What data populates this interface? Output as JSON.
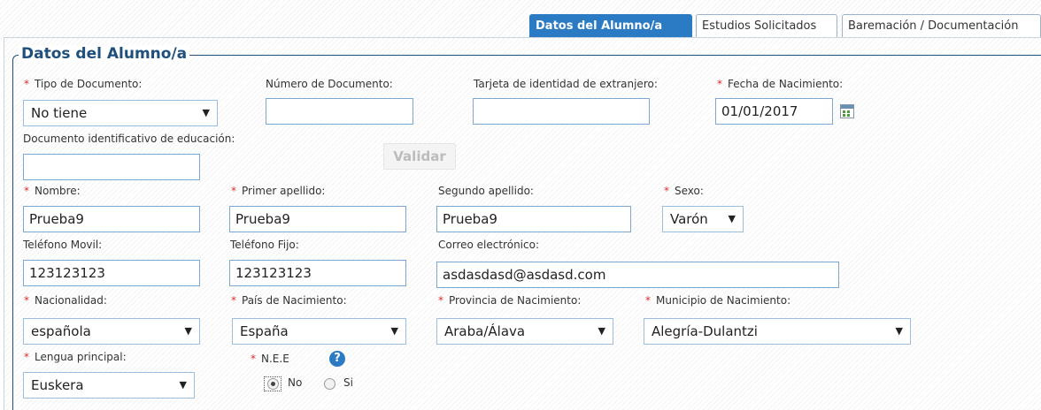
{
  "tabs": [
    "Datos del Alumno/a",
    "Estudios Solicitados",
    "Baremación / Documentación"
  ],
  "section_title": "Datos del Alumno/a",
  "required_mark": "*",
  "labels": {
    "tipo_documento": "Tipo de Documento:",
    "numero_documento": "Número de Documento:",
    "tarjeta_extranjero": "Tarjeta de identidad de extranjero:",
    "fecha_nacimiento": "Fecha de Nacimiento:",
    "doc_educacion": "Documento identificativo de educación:",
    "nombre": "Nombre:",
    "primer_apellido": "Primer apellido:",
    "segundo_apellido": "Segundo apellido:",
    "sexo": "Sexo:",
    "telefono_movil": "Teléfono Movil:",
    "telefono_fijo": "Teléfono Fijo:",
    "correo": "Correo electrónico:",
    "nacionalidad": "Nacionalidad:",
    "pais_nacimiento": "País de Nacimiento:",
    "provincia_nacimiento": "Provincia de Nacimiento:",
    "municipio_nacimiento": "Municipio de Nacimiento:",
    "lengua_principal": "Lengua principal:",
    "nee": "N.E.E"
  },
  "values": {
    "tipo_documento": "No tiene",
    "numero_documento": "",
    "tarjeta_extranjero": "",
    "fecha_nacimiento": "01/01/2017",
    "doc_educacion": "",
    "nombre": "Prueba9",
    "primer_apellido": "Prueba9",
    "segundo_apellido": "Prueba9",
    "sexo": "Varón",
    "telefono_movil": "123123123",
    "telefono_fijo": "123123123",
    "correo": "asdasdasd@asdasd.com",
    "nacionalidad": "española",
    "pais_nacimiento": "España",
    "provincia_nacimiento": "Araba/Álava",
    "municipio_nacimiento": "Alegría-Dulantzi",
    "lengua_principal": "Euskera"
  },
  "validar_label": "Validar",
  "help_glyph": "?",
  "arrow_glyph": "▼",
  "nee_options": [
    {
      "label": "No",
      "selected": true
    },
    {
      "label": "Si",
      "selected": false
    }
  ],
  "icons": {
    "calendar": "calendar-icon",
    "help": "help-icon"
  },
  "colors": {
    "accent": "#2b7bc4",
    "heading": "#1f4f7d",
    "required": "#d9302c",
    "input_border": "#7aa7d4"
  }
}
